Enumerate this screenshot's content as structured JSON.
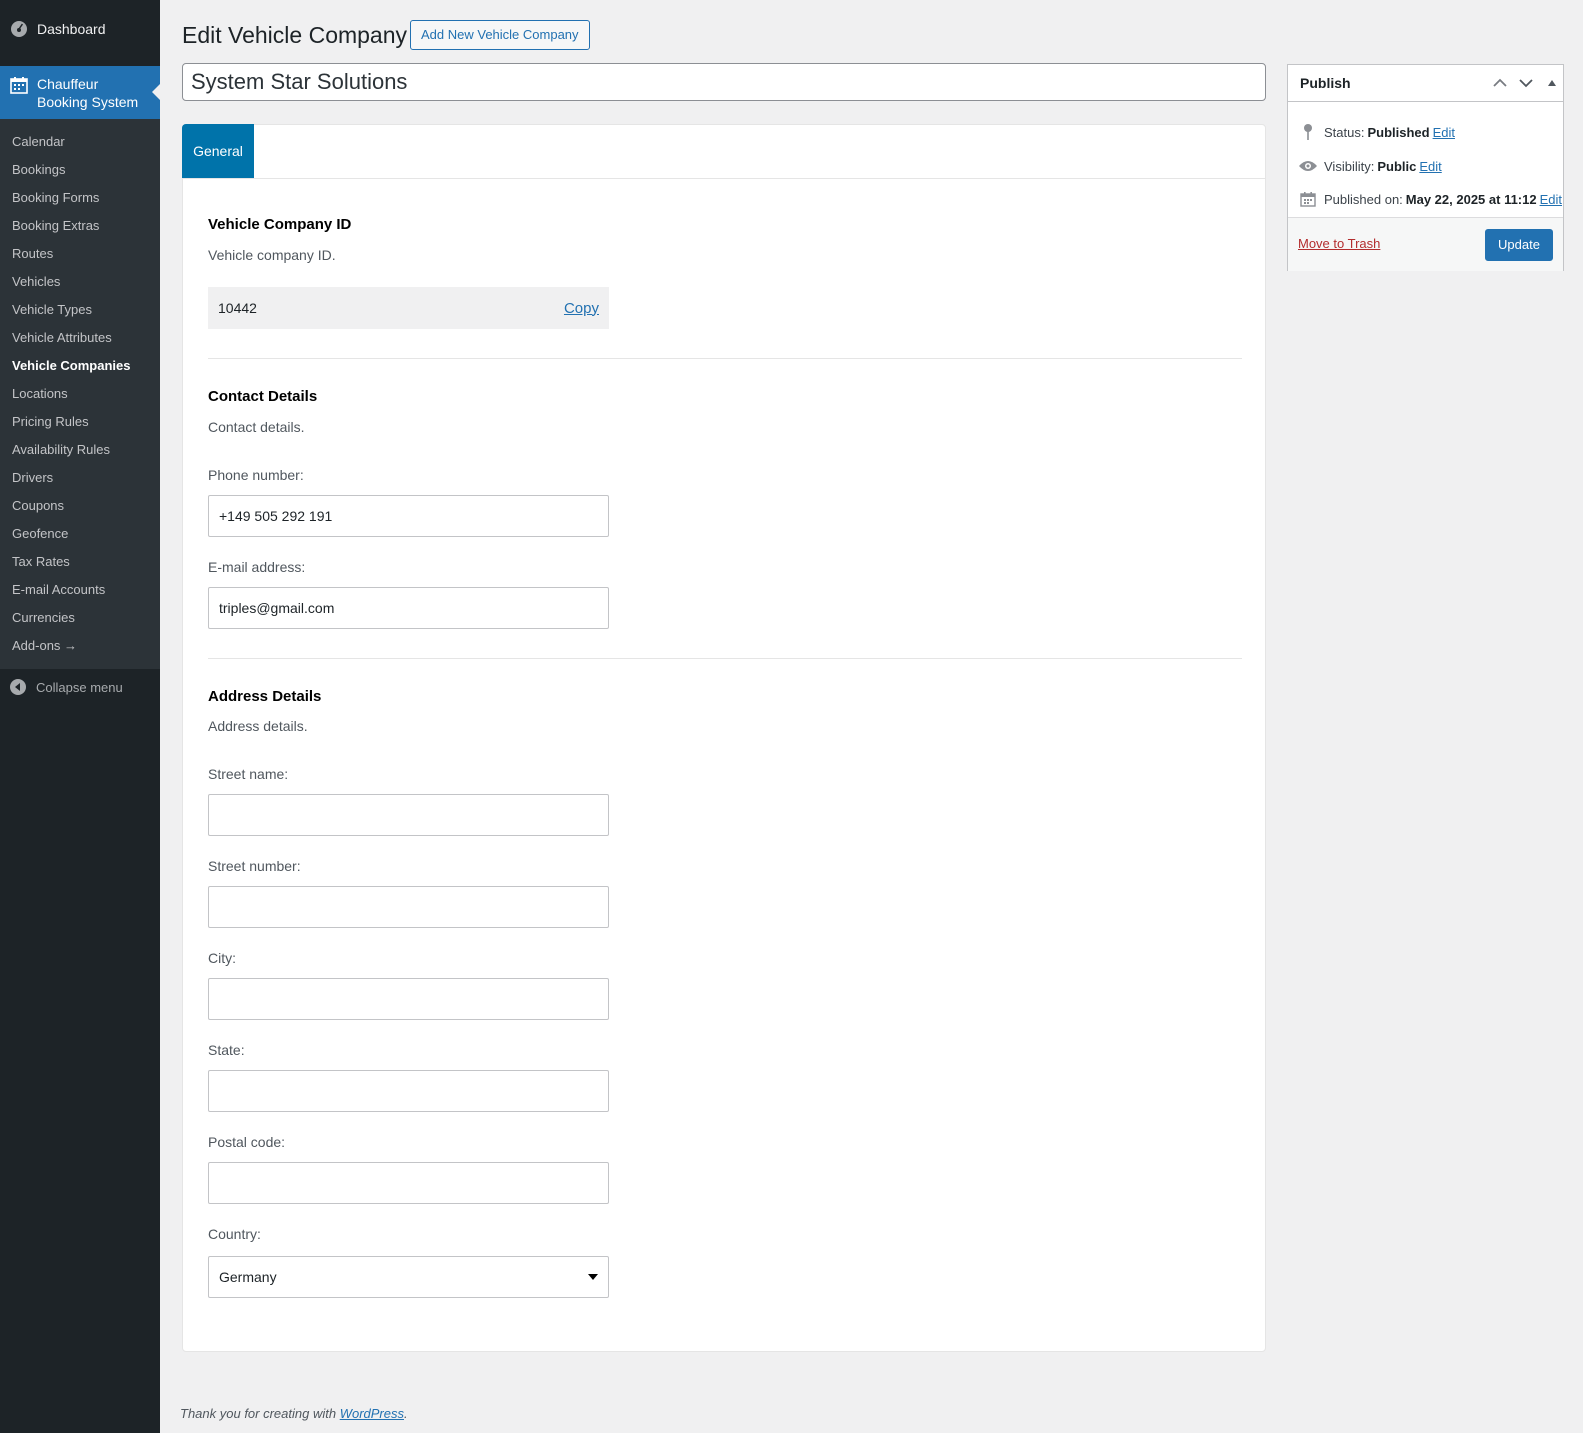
{
  "sidebar": {
    "dashboard_label": "Dashboard",
    "active_menu_label_line1": "Chauffeur",
    "active_menu_label_line2": "Booking System",
    "items": [
      {
        "label": "Calendar"
      },
      {
        "label": "Bookings"
      },
      {
        "label": "Booking Forms"
      },
      {
        "label": "Booking Extras"
      },
      {
        "label": "Routes"
      },
      {
        "label": "Vehicles"
      },
      {
        "label": "Vehicle Types"
      },
      {
        "label": "Vehicle Attributes"
      },
      {
        "label": "Vehicle Companies",
        "current": true
      },
      {
        "label": "Locations"
      },
      {
        "label": "Pricing Rules"
      },
      {
        "label": "Availability Rules"
      },
      {
        "label": "Drivers"
      },
      {
        "label": "Coupons"
      },
      {
        "label": "Geofence"
      },
      {
        "label": "Tax Rates"
      },
      {
        "label": "E-mail Accounts"
      },
      {
        "label": "Currencies"
      },
      {
        "label": "Add-ons →"
      }
    ],
    "collapse_label": "Collapse menu"
  },
  "header": {
    "title": "Edit Vehicle Company",
    "add_new_label": "Add New Vehicle Company",
    "post_title": "System Star Solutions"
  },
  "tabs": [
    {
      "label": "General"
    }
  ],
  "sections": {
    "id": {
      "title": "Vehicle Company ID",
      "desc": "Vehicle company ID.",
      "value": "10442",
      "copy_label": "Copy"
    },
    "contact": {
      "title": "Contact Details",
      "desc": "Contact details.",
      "phone_label": "Phone number:",
      "phone_value": "+149 505 292 191",
      "email_label": "E-mail address:",
      "email_value": "triples@gmail.com"
    },
    "address": {
      "title": "Address Details",
      "desc": "Address details.",
      "street_name_label": "Street name:",
      "street_number_label": "Street number:",
      "city_label": "City:",
      "state_label": "State:",
      "postal_label": "Postal code:",
      "country_label": "Country:",
      "country_value": "Germany"
    }
  },
  "publish": {
    "title": "Publish",
    "status_label": "Status:",
    "status_value": "Published",
    "visibility_label": "Visibility:",
    "visibility_value": "Public",
    "published_label": "Published on:",
    "published_value": "May 22, 2025 at 11:12",
    "edit_label": "Edit",
    "trash_label": "Move to Trash",
    "update_label": "Update"
  },
  "footer": {
    "text": "Thank you for creating with",
    "link": "WordPress",
    "suffix": "."
  },
  "colors": {
    "sidebar_bg": "#1d2327",
    "submenu_bg": "#2c3338",
    "accent": "#2271b1",
    "tab_active": "#0073aa",
    "trash": "#b32d2e"
  }
}
